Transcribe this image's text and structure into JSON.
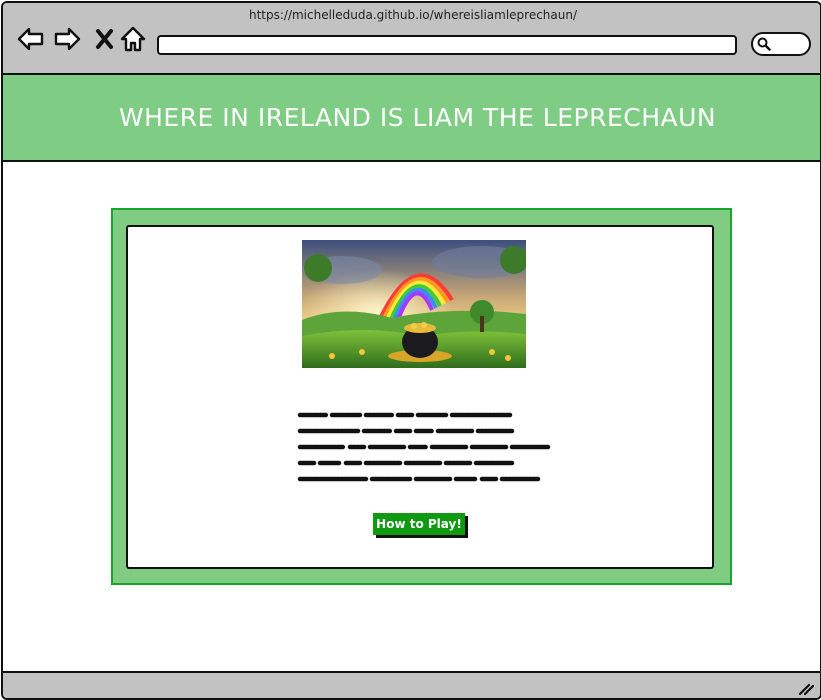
{
  "browser": {
    "url": "https://michelleduda.github.io/whereisliamleprechaun/",
    "icons": [
      "back-arrow-icon",
      "forward-arrow-icon",
      "close-x-icon",
      "home-icon",
      "search-icon",
      "resize-grip-icon"
    ]
  },
  "header": {
    "title": "WHERE IN IRELAND IS LIAM THE LEPRECHAUN",
    "background": "#7fcc84"
  },
  "main": {
    "frame_color": "#80cc82",
    "frame_border": "#17a52b",
    "hero_image": "rainbow-pot-of-gold",
    "cta_label": "How to Play!",
    "cta_color": "#0f9a12"
  }
}
